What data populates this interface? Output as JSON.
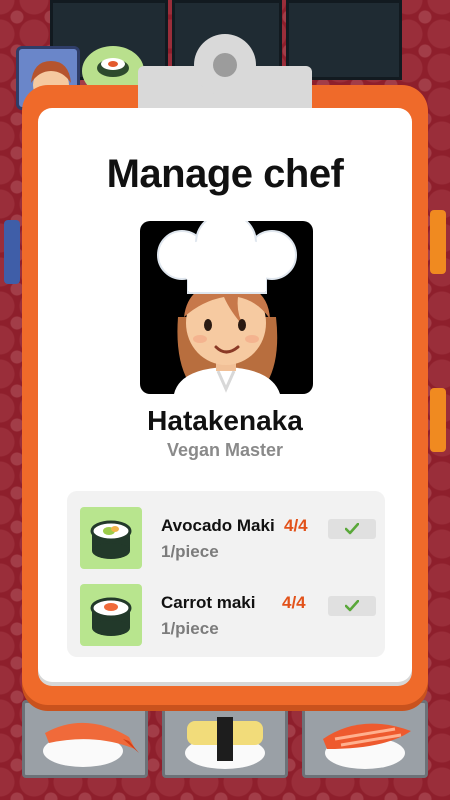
{
  "dialog": {
    "title": "Manage chef"
  },
  "chef": {
    "name": "Hatakenaka",
    "rank": "Vegan Master",
    "portrait_icon": "chef-woman-portrait"
  },
  "recipes": [
    {
      "name": "Avocado Maki",
      "count": "4/4",
      "price": "1/piece",
      "icon": "avocado-maki-icon",
      "status_icon": "check-icon"
    },
    {
      "name": "Carrot maki",
      "count": "4/4",
      "price": "1/piece",
      "icon": "carrot-maki-icon",
      "status_icon": "check-icon"
    }
  ],
  "colors": {
    "frame": "#ef6a2a",
    "count": "#e2521a",
    "check": "#5aa83a",
    "thumb_bg": "#b8e58e"
  }
}
